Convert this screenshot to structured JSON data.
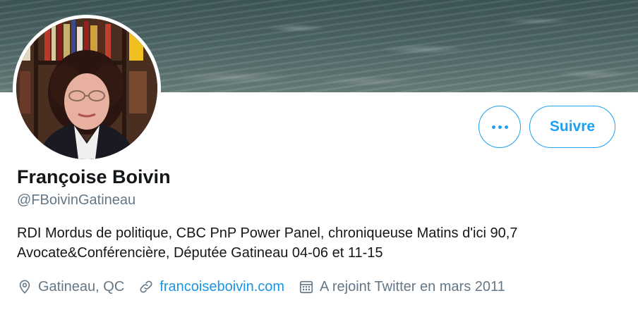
{
  "profile": {
    "name": "Françoise Boivin",
    "handle": "@FBoivinGatineau",
    "bio_line1": "RDI Mordus de politique, CBC PnP Power Panel, chroniqueuse Matins d'ici 90,7",
    "bio_line2": "Avocate&Conférencière, Députée Gatineau 04-06 et 11-15",
    "location": "Gatineau, QC",
    "website": "francoiseboivin.com",
    "joined": "A rejoint Twitter en mars 2011"
  },
  "actions": {
    "follow_label": "Suivre",
    "more_icon": "more-dots-icon"
  },
  "icons": {
    "location": "location-pin-icon",
    "website": "link-icon",
    "joined": "calendar-icon"
  },
  "colors": {
    "accent": "#1da1f2",
    "link": "#1b95e0",
    "secondary_text": "#657786",
    "primary_text": "#14171a"
  }
}
